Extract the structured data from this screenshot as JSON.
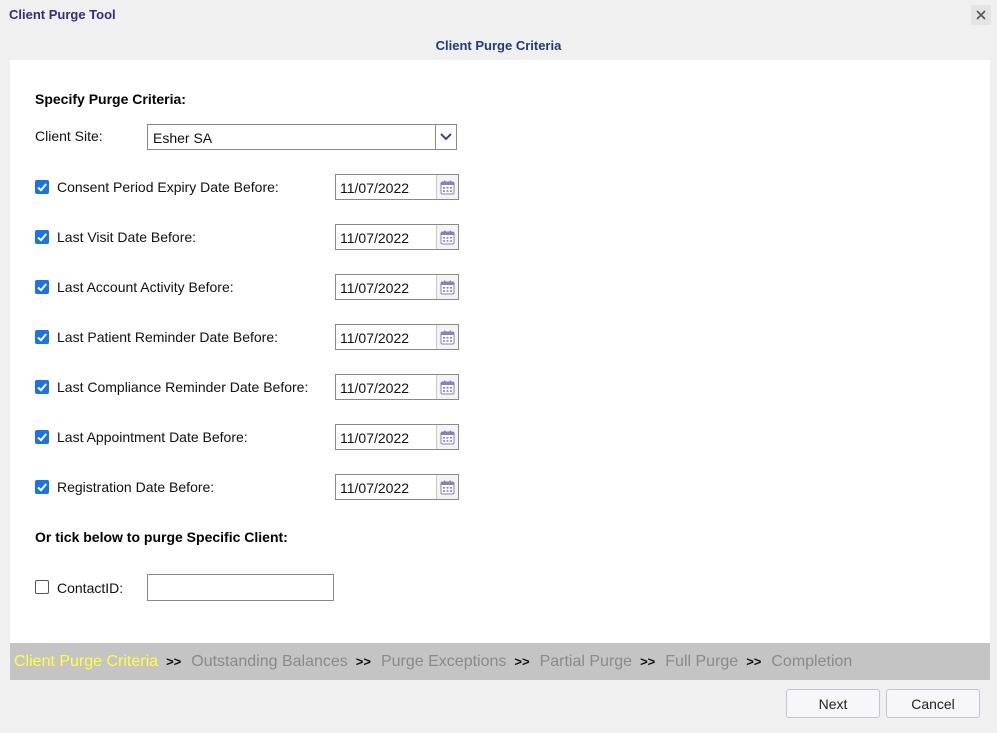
{
  "window": {
    "title": "Client Purge Tool",
    "subtitle": "Client Purge Criteria"
  },
  "criteria": {
    "heading": "Specify Purge Criteria:",
    "client_site_label": "Client Site:",
    "client_site_value": "Esher SA",
    "rows": [
      {
        "label": "Consent Period Expiry Date Before:",
        "checked": true,
        "date": "11/07/2022"
      },
      {
        "label": "Last Visit Date Before:",
        "checked": true,
        "date": "11/07/2022"
      },
      {
        "label": "Last Account Activity Before:",
        "checked": true,
        "date": "11/07/2022"
      },
      {
        "label": "Last Patient Reminder Date Before:",
        "checked": true,
        "date": "11/07/2022"
      },
      {
        "label": "Last Compliance Reminder Date Before:",
        "checked": true,
        "date": "11/07/2022"
      },
      {
        "label": "Last Appointment Date Before:",
        "checked": true,
        "date": "11/07/2022"
      },
      {
        "label": "Registration Date Before:",
        "checked": true,
        "date": "11/07/2022"
      }
    ]
  },
  "specific": {
    "heading": "Or tick below to purge Specific Client:",
    "contact_label": "ContactID:",
    "contact_checked": false,
    "contact_value": ""
  },
  "wizard": {
    "separator": ">>",
    "steps": [
      {
        "label": "Client Purge Criteria",
        "active": true
      },
      {
        "label": "Outstanding Balances",
        "active": false
      },
      {
        "label": "Purge Exceptions",
        "active": false
      },
      {
        "label": "Partial Purge",
        "active": false
      },
      {
        "label": "Full Purge",
        "active": false
      },
      {
        "label": "Completion",
        "active": false
      }
    ]
  },
  "buttons": {
    "next": "Next",
    "cancel": "Cancel"
  },
  "colors": {
    "title": "#3b2a7a",
    "subtitle": "#213a7a",
    "checkbox": "#1a73e8",
    "active_step": "#ffff3c",
    "inactive_step": "#8a8a8a",
    "wizard_bar": "#c4c4c4",
    "dropdown_chevron": "#4a3a8a"
  },
  "icons": {
    "close": "close-icon",
    "dropdown": "chevron-down-icon",
    "date_picker": "calendar-icon"
  }
}
